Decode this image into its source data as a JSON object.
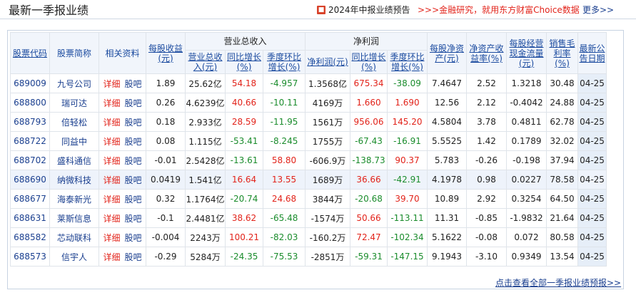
{
  "header": {
    "title": "最新一季报业绩",
    "forecast_icon": "report-icon",
    "forecast_link": "2024年中报业绩预告",
    "promo_link": ">>>金融研究，就用东方财富Choice数据",
    "more_link": "更多>>"
  },
  "table": {
    "group_headers": {
      "revenue": "营业总收入",
      "net_profit": "净利润"
    },
    "columns": {
      "code": "股票代码",
      "name": "股票简称",
      "related": "相关资料",
      "eps": "每股收益(元)",
      "revenue": "营业总收入(元)",
      "revenue_yoy": "同比增长(%)",
      "revenue_qoq": "季度环比增长(%)",
      "net_profit": "净利润(元)",
      "profit_yoy": "同比增长(%)",
      "profit_qoq": "季度环比增长(%)",
      "bvps": "每股净资产(元)",
      "roe": "净资产收益率(%)",
      "ocf": "每股经营现金流量(元)",
      "gross_margin": "销售毛利率(%)",
      "date": "最新公告日期"
    },
    "link_detail": "详细",
    "link_forum": "股吧",
    "rows": [
      {
        "code": "689009",
        "name": "九号公司",
        "eps": "1.89",
        "revenue": "25.62亿",
        "revenue_yoy": "54.18",
        "revenue_qoq": "-4.957",
        "net_profit": "1.3568亿",
        "profit_yoy": "675.34",
        "profit_qoq": "-38.09",
        "bvps": "7.4647",
        "roe": "2.52",
        "ocf": "1.3218",
        "gross_margin": "30.48",
        "date": "04-25"
      },
      {
        "code": "688800",
        "name": "瑞可达",
        "eps": "0.26",
        "revenue": "4.6239亿",
        "revenue_yoy": "40.66",
        "revenue_qoq": "-10.11",
        "net_profit": "4169万",
        "profit_yoy": "1.660",
        "profit_qoq": "1.690",
        "bvps": "12.56",
        "roe": "2.12",
        "ocf": "-0.4042",
        "gross_margin": "24.88",
        "date": "04-25"
      },
      {
        "code": "688793",
        "name": "倍轻松",
        "eps": "0.18",
        "revenue": "2.933亿",
        "revenue_yoy": "28.59",
        "revenue_qoq": "-11.95",
        "net_profit": "1561万",
        "profit_yoy": "956.06",
        "profit_qoq": "145.20",
        "bvps": "4.5804",
        "roe": "3.78",
        "ocf": "0.4811",
        "gross_margin": "62.78",
        "date": "04-25"
      },
      {
        "code": "688722",
        "name": "同益中",
        "eps": "0.08",
        "revenue": "1.115亿",
        "revenue_yoy": "-53.41",
        "revenue_qoq": "-8.245",
        "net_profit": "1755万",
        "profit_yoy": "-67.43",
        "profit_qoq": "-16.91",
        "bvps": "5.5525",
        "roe": "1.42",
        "ocf": "0.1789",
        "gross_margin": "32.02",
        "date": "04-25"
      },
      {
        "code": "688702",
        "name": "盛科通信",
        "eps": "-0.01",
        "revenue": "2.5428亿",
        "revenue_yoy": "-13.61",
        "revenue_qoq": "58.80",
        "net_profit": "-606.9万",
        "profit_yoy": "-138.73",
        "profit_qoq": "90.37",
        "bvps": "5.783",
        "roe": "-0.26",
        "ocf": "-0.198",
        "gross_margin": "37.94",
        "date": "04-25"
      },
      {
        "code": "688690",
        "name": "纳微科技",
        "eps": "0.0419",
        "revenue": "1.541亿",
        "revenue_yoy": "16.64",
        "revenue_qoq": "13.55",
        "net_profit": "1689万",
        "profit_yoy": "36.66",
        "profit_qoq": "-42.91",
        "bvps": "4.1978",
        "roe": "0.98",
        "ocf": "0.0227",
        "gross_margin": "78.58",
        "date": "04-25"
      },
      {
        "code": "688677",
        "name": "海泰新光",
        "eps": "0.32",
        "revenue": "1.1764亿",
        "revenue_yoy": "-20.74",
        "revenue_qoq": "24.68",
        "net_profit": "3844万",
        "profit_yoy": "-20.68",
        "profit_qoq": "39.70",
        "bvps": "10.89",
        "roe": "2.92",
        "ocf": "0.3254",
        "gross_margin": "64.50",
        "date": "04-25"
      },
      {
        "code": "688631",
        "name": "莱斯信息",
        "eps": "-0.1",
        "revenue": "2.4481亿",
        "revenue_yoy": "38.62",
        "revenue_qoq": "-65.48",
        "net_profit": "-1574万",
        "profit_yoy": "50.66",
        "profit_qoq": "-113.11",
        "bvps": "11.31",
        "roe": "-0.85",
        "ocf": "-1.9832",
        "gross_margin": "21.64",
        "date": "04-25"
      },
      {
        "code": "688582",
        "name": "芯动联科",
        "eps": "-0.004",
        "revenue": "2243万",
        "revenue_yoy": "100.21",
        "revenue_qoq": "-82.03",
        "net_profit": "-160.2万",
        "profit_yoy": "72.47",
        "profit_qoq": "-102.34",
        "bvps": "5.1622",
        "roe": "-0.08",
        "ocf": "0.072",
        "gross_margin": "80.58",
        "date": "04-25"
      },
      {
        "code": "688573",
        "name": "信宇人",
        "eps": "-0.29",
        "revenue": "5284万",
        "revenue_yoy": "-24.35",
        "revenue_qoq": "-75.53",
        "net_profit": "-2851万",
        "profit_yoy": "-59.31",
        "profit_qoq": "-147.15",
        "bvps": "9.1943",
        "roe": "-3.10",
        "ocf": "0.9349",
        "gross_margin": "13.54",
        "date": "04-25"
      }
    ],
    "footer_link": "点击查看全部一季报业绩预报>>"
  },
  "colors": {
    "positive": "#e2231a",
    "negative": "#1a8c2c",
    "link": "#1a3f8f",
    "header_bg": "#f1f5fb",
    "highlight_row": "#eef3fb"
  }
}
